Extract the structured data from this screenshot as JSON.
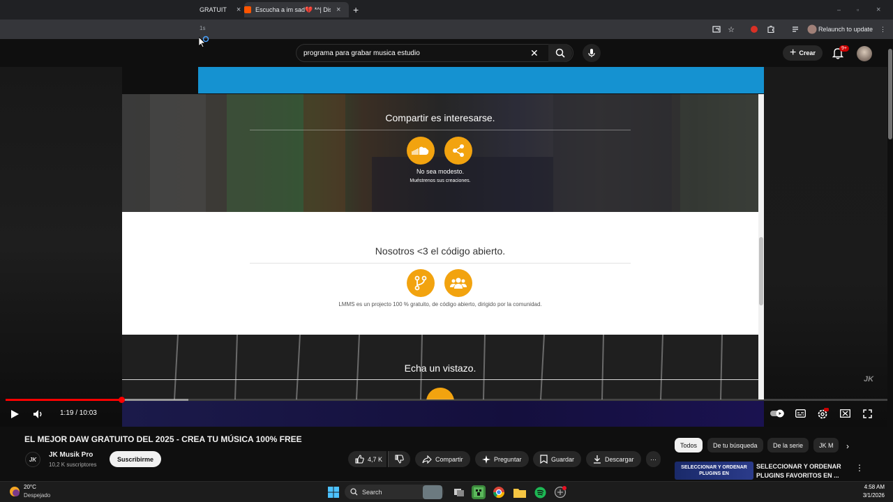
{
  "browser": {
    "tabs": [
      {
        "label": "GRATUIT",
        "close": "×"
      },
      {
        "label": "Escucha a im sad💔 *^| Disfru",
        "close": "×"
      }
    ],
    "new_tab": "+",
    "address_fragment": "1s",
    "relaunch_label": "Relaunch to update"
  },
  "youtube": {
    "search_query": "programa para grabar musica estudio",
    "create_label": "Crear",
    "notification_count": "9+"
  },
  "site": {
    "section1_title": "Compartir es interesarse.",
    "section1_line1": "No sea modesto.",
    "section1_line2": "Muéstrenos sus creaciones.",
    "section2_title": "Nosotros <3 el código abierto.",
    "section2_text": "LMMS es un projecto 100 % gratuito, de código abierto, dirigido por la comunidad.",
    "section3_title": "Echa un vistazo."
  },
  "player": {
    "time": "1:19 / 10:03",
    "progress_fraction": 0.131,
    "buffer_fraction": 0.207,
    "watermark": "JK"
  },
  "video": {
    "title": "EL MEJOR DAW GRATUITO DEL 2025 - CREA TU MÚSICA 100% FREE",
    "channel_name": "JK Musik Pro",
    "channel_subs": "10,2 K suscriptores",
    "channel_avatar_text": "JK",
    "subscribe_label": "Suscribirme",
    "likes": "4,7 K",
    "share_label": "Compartir",
    "ask_label": "Preguntar",
    "save_label": "Guardar",
    "download_label": "Descargar",
    "more_label": "···"
  },
  "sidebar": {
    "chips": [
      "Todos",
      "De tu búsqueda",
      "De la serie",
      "JK M"
    ],
    "rec_thumb_line1": "SELECCIONAR Y ORDENAR",
    "rec_thumb_line2": "PLUGINS EN",
    "rec_title": "SELECCIONAR Y ORDENAR PLUGINS FAVORITOS EN ..."
  },
  "taskbar": {
    "temperature": "20°C",
    "condition": "Despejado",
    "search_label": "Search",
    "time": "4:58 AM",
    "date": "3/1/2026"
  },
  "colors": {
    "accent_red": "#ff0000",
    "site_blue": "#1592d1",
    "site_orange": "#f2a30f"
  }
}
